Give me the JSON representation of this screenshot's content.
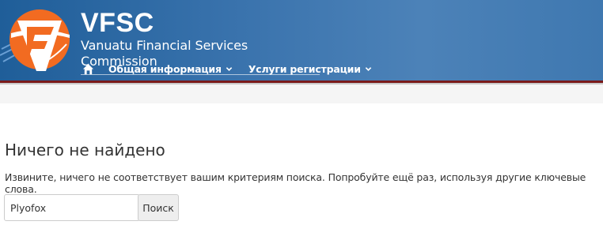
{
  "header": {
    "brand_name": "VFSC",
    "brand_subtitle": "Vanuatu Financial Services Commission",
    "nav": {
      "home_icon": "home-icon",
      "items": [
        {
          "label": "Общая информация",
          "icon": "chevron-down-icon"
        },
        {
          "label": "Услуги регистрации",
          "icon": "chevron-down-icon"
        }
      ]
    },
    "colors": {
      "bar": "#3a73ad",
      "accent_line": "#7a1a1a",
      "logo_orange": "#f26b21"
    }
  },
  "main": {
    "title": "Ничего не найдено",
    "message": "Извините, ничего не соответствует вашим критериям поиска. Попробуйте ещё раз, используя другие ключевые слова.",
    "search": {
      "value": "Plyofox",
      "button_label": "Поиск"
    }
  }
}
